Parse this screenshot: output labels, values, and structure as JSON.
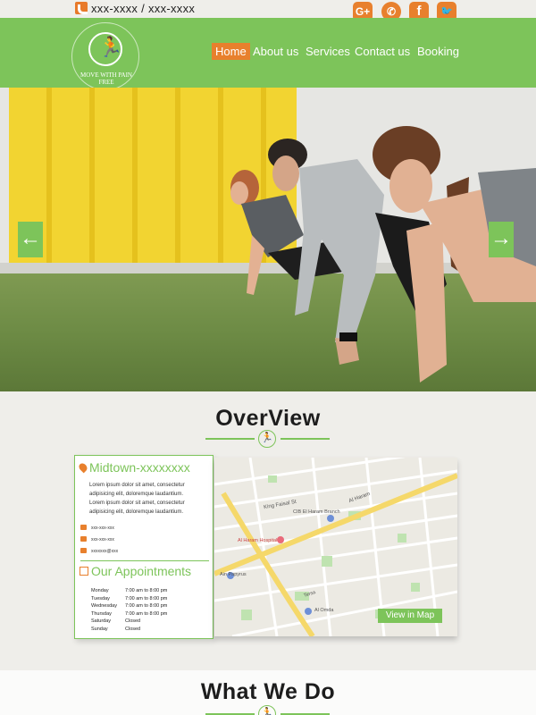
{
  "topbar": {
    "phone": "xxx-xxxx / xxx-xxxx"
  },
  "social": [
    {
      "name": "google-plus-icon",
      "glyph": "G+"
    },
    {
      "name": "whatsapp-icon",
      "glyph": "✆"
    },
    {
      "name": "facebook-icon",
      "glyph": "f"
    },
    {
      "name": "twitter-icon",
      "glyph": "🐦"
    }
  ],
  "logo": {
    "brand": "MOVE WITH PAIN FREE"
  },
  "nav": {
    "home": "Home",
    "about": "About us",
    "services": "Services",
    "contact": "Contact us",
    "booking": "Booking"
  },
  "hero": {
    "prev": "←",
    "next": "→"
  },
  "overview": {
    "title": "OverView",
    "location": "Midtown-xxxxxxxx",
    "lorem1": "Lorem ipsum dolor sit amet, consectetur adipisicing elit, doloremque laudantium.",
    "lorem2": "Lorem ipsum dolor sit amet, consectetur adipisicing elit, doloremque laudantium.",
    "phone1": "xxx-xxx-xxx",
    "phone2": "xxx-xxx-xxx",
    "email": "xxxxxxx@xxx",
    "appointments_title": "Our Appointments",
    "schedule": [
      {
        "day": "Monday",
        "time": "7:00 am to 8:00 pm"
      },
      {
        "day": "Tuesday",
        "time": "7:00 am to 8:00 pm"
      },
      {
        "day": "Wednesday",
        "time": "7:00 am to 8:00 pm"
      },
      {
        "day": "Thursday",
        "time": "7:00 am to 8:00 pm"
      },
      {
        "day": "Saturday",
        "time": "Closed"
      },
      {
        "day": "Sunday",
        "time": "Closed"
      }
    ],
    "map_button": "View in Map",
    "map_labels": {
      "king_faisal": "King Faisal St",
      "al_haram": "Al Haram",
      "cib": "CIB El Haram Branch",
      "hospital": "Al Haram Hospital",
      "ain": "Ain Papyrus",
      "omda": "Al Omda",
      "tersa": "Tersa"
    }
  },
  "whatwedo": {
    "title": "What We Do"
  },
  "colors": {
    "green": "#7dc45a",
    "orange": "#e8802d"
  }
}
